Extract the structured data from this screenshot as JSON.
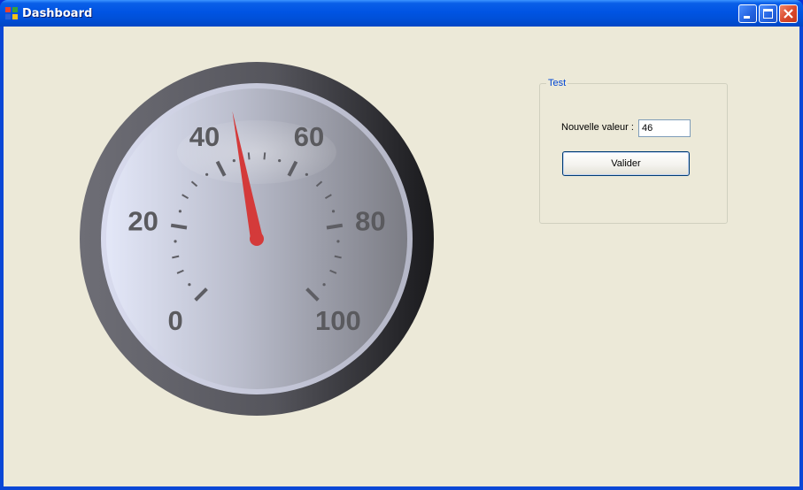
{
  "window": {
    "title": "Dashboard"
  },
  "gauge": {
    "value": 46,
    "min": 0,
    "max": 100,
    "major_labels": [
      "0",
      "20",
      "40",
      "60",
      "80",
      "100"
    ],
    "colors": {
      "needle": "#d43a3a",
      "bezel_dark": "#1a1a1d",
      "bezel_light": "#6e6e76",
      "face_light": "#e3e7f8",
      "face_dark": "#7b7c84",
      "label": "#5a5a5e"
    }
  },
  "group": {
    "title": "Test",
    "field_label": "Nouvelle valeur :",
    "input_value": "46",
    "button_label": "Valider"
  },
  "colors": {
    "title_bar": "#0054e3",
    "client_bg": "#ece9d8",
    "group_title": "#0046d5"
  },
  "icons": {
    "app": "app-icon",
    "minimize": "minimize-icon",
    "maximize": "maximize-icon",
    "close": "close-icon"
  }
}
